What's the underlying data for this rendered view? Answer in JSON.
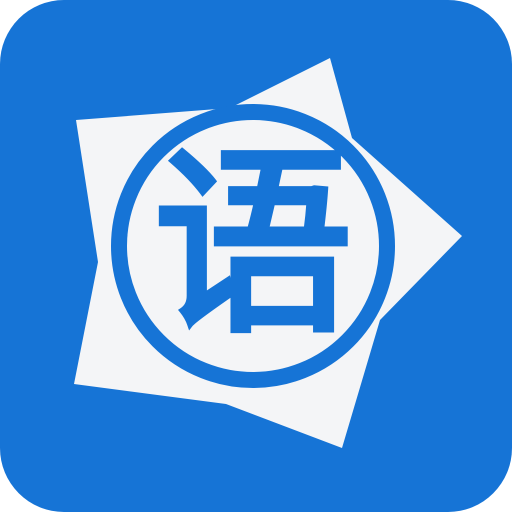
{
  "app_icon": {
    "character": "语",
    "colors": {
      "tile_background": "#1674D6",
      "star_fill": "#F4F5F7",
      "glyph": "#1674D6",
      "ring": "#1674D6"
    },
    "icon_names": [
      "star-shape-icon",
      "circle-ring-icon",
      "chinese-character-yu-icon"
    ]
  }
}
